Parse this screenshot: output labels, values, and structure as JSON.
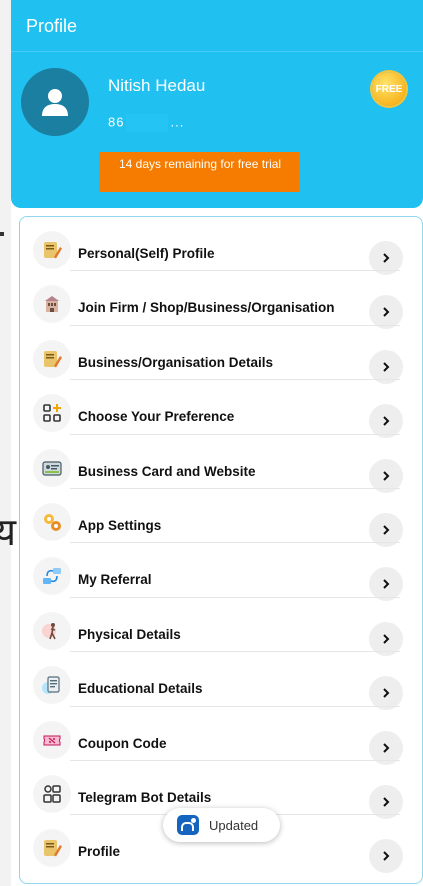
{
  "header": {
    "title": "Profile"
  },
  "user": {
    "name": "Nitish Hedau",
    "phone_prefix": "86",
    "phone_suffix": "..."
  },
  "trial": {
    "text": "14 days remaining for free trial"
  },
  "free_badge": {
    "label": "FREE"
  },
  "menu": {
    "items": [
      {
        "label": "Personal(Self) Profile",
        "icon": "notebook-pencil-icon"
      },
      {
        "label": "Join Firm / Shop/Business/Organisation",
        "icon": "office-building-icon"
      },
      {
        "label": "Business/Organisation Details",
        "icon": "notebook-pencil-icon"
      },
      {
        "label": "Choose Your Preference",
        "icon": "grid-plus-icon"
      },
      {
        "label": "Business Card and Website",
        "icon": "id-card-icon"
      },
      {
        "label": "App Settings",
        "icon": "gears-icon"
      },
      {
        "label": "My Referral",
        "icon": "referral-icon"
      },
      {
        "label": "Physical Details",
        "icon": "person-figure-icon"
      },
      {
        "label": "Educational Details",
        "icon": "document-icon"
      },
      {
        "label": "Coupon Code",
        "icon": "coupon-icon"
      },
      {
        "label": "Telegram Bot Details",
        "icon": "bot-grid-icon"
      },
      {
        "label": "Profile",
        "icon": "notebook-pencil-icon"
      }
    ]
  },
  "toast": {
    "label": "Updated"
  },
  "background": {
    "glyph": "य"
  },
  "colors": {
    "header": "#20c0f0",
    "trial": "#f57c00",
    "avatar": "#1a7fa0",
    "card_border": "#8fd6ee"
  }
}
